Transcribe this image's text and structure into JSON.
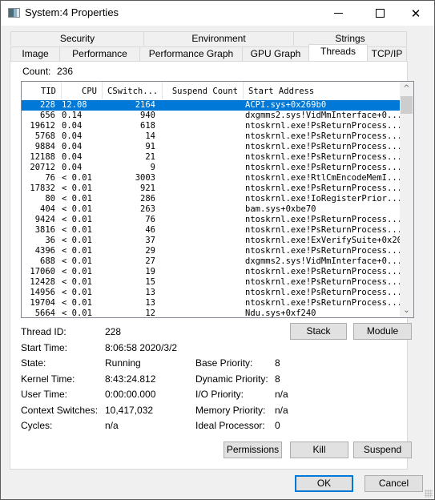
{
  "window": {
    "title": "System:4 Properties",
    "icon": "app-window-icon",
    "controls": {
      "minimize": "minimize-icon",
      "maximize": "maximize-icon",
      "close": "✕"
    }
  },
  "tabs": {
    "row1": [
      {
        "label": "Security"
      },
      {
        "label": "Environment"
      },
      {
        "label": "Strings"
      }
    ],
    "row2": [
      {
        "label": "Image"
      },
      {
        "label": "Performance"
      },
      {
        "label": "Performance Graph"
      },
      {
        "label": "GPU Graph"
      },
      {
        "label": "Threads",
        "active": true
      },
      {
        "label": "TCP/IP"
      }
    ]
  },
  "threads": {
    "count_label": "Count:",
    "count_value": "236",
    "columns": [
      "TID",
      "CPU",
      "CSwitch...",
      "Suspend Count",
      "Start Address"
    ],
    "sort_indicator": "˅",
    "rows": [
      {
        "tid": "228",
        "cpu": "12.08",
        "cswitch": "2164",
        "suspend": "",
        "address": "ACPI.sys+0x269b0",
        "selected": true
      },
      {
        "tid": "656",
        "cpu": "0.14",
        "cswitch": "940",
        "suspend": "",
        "address": "dxgmms2.sys!VidMmInterface+0..."
      },
      {
        "tid": "19612",
        "cpu": "0.04",
        "cswitch": "618",
        "suspend": "",
        "address": "ntoskrnl.exe!PsReturnProcess..."
      },
      {
        "tid": "5768",
        "cpu": "0.04",
        "cswitch": "14",
        "suspend": "",
        "address": "ntoskrnl.exe!PsReturnProcess..."
      },
      {
        "tid": "9884",
        "cpu": "0.04",
        "cswitch": "91",
        "suspend": "",
        "address": "ntoskrnl.exe!PsReturnProcess..."
      },
      {
        "tid": "12188",
        "cpu": "0.04",
        "cswitch": "21",
        "suspend": "",
        "address": "ntoskrnl.exe!PsReturnProcess..."
      },
      {
        "tid": "20712",
        "cpu": "0.04",
        "cswitch": "9",
        "suspend": "",
        "address": "ntoskrnl.exe!PsReturnProcess..."
      },
      {
        "tid": "76",
        "cpu": "< 0.01",
        "cswitch": "3003",
        "suspend": "",
        "address": "ntoskrnl.exe!RtlCmEncodeMemI..."
      },
      {
        "tid": "17832",
        "cpu": "< 0.01",
        "cswitch": "921",
        "suspend": "",
        "address": "ntoskrnl.exe!PsReturnProcess..."
      },
      {
        "tid": "80",
        "cpu": "< 0.01",
        "cswitch": "286",
        "suspend": "",
        "address": "ntoskrnl.exe!IoRegisterPrior..."
      },
      {
        "tid": "404",
        "cpu": "< 0.01",
        "cswitch": "263",
        "suspend": "",
        "address": "bam.sys+0xbe70"
      },
      {
        "tid": "9424",
        "cpu": "< 0.01",
        "cswitch": "76",
        "suspend": "",
        "address": "ntoskrnl.exe!PsReturnProcess..."
      },
      {
        "tid": "3816",
        "cpu": "< 0.01",
        "cswitch": "46",
        "suspend": "",
        "address": "ntoskrnl.exe!PsReturnProcess..."
      },
      {
        "tid": "36",
        "cpu": "< 0.01",
        "cswitch": "37",
        "suspend": "",
        "address": "ntoskrnl.exe!ExVerifySuite+0x20"
      },
      {
        "tid": "4396",
        "cpu": "< 0.01",
        "cswitch": "29",
        "suspend": "",
        "address": "ntoskrnl.exe!PsReturnProcess..."
      },
      {
        "tid": "688",
        "cpu": "< 0.01",
        "cswitch": "27",
        "suspend": "",
        "address": "dxgmms2.sys!VidMmInterface+0..."
      },
      {
        "tid": "17060",
        "cpu": "< 0.01",
        "cswitch": "19",
        "suspend": "",
        "address": "ntoskrnl.exe!PsReturnProcess..."
      },
      {
        "tid": "12428",
        "cpu": "< 0.01",
        "cswitch": "15",
        "suspend": "",
        "address": "ntoskrnl.exe!PsReturnProcess..."
      },
      {
        "tid": "14956",
        "cpu": "< 0.01",
        "cswitch": "13",
        "suspend": "",
        "address": "ntoskrnl.exe!PsReturnProcess..."
      },
      {
        "tid": "19704",
        "cpu": "< 0.01",
        "cswitch": "13",
        "suspend": "",
        "address": "ntoskrnl.exe!PsReturnProcess..."
      },
      {
        "tid": "5664",
        "cpu": "< 0.01",
        "cswitch": "12",
        "suspend": "",
        "address": "Ndu.sys+0xf240"
      }
    ]
  },
  "details": {
    "left": [
      {
        "label": "Thread ID:",
        "value": "228"
      },
      {
        "label": "Start Time:",
        "value": "8:06:58   2020/3/2"
      },
      {
        "label": "State:",
        "value": "Running"
      },
      {
        "label": "Kernel Time:",
        "value": "8:43:24.812"
      },
      {
        "label": "User Time:",
        "value": "0:00:00.000"
      },
      {
        "label": "Context Switches:",
        "value": "10,417,032"
      },
      {
        "label": "Cycles:",
        "value": "n/a"
      }
    ],
    "right": [
      {
        "label": "Base Priority:",
        "value": "8"
      },
      {
        "label": "Dynamic Priority:",
        "value": "8"
      },
      {
        "label": "I/O Priority:",
        "value": "n/a"
      },
      {
        "label": "Memory Priority:",
        "value": "n/a"
      },
      {
        "label": "Ideal Processor:",
        "value": "0"
      }
    ]
  },
  "buttons": {
    "stack": "Stack",
    "module": "Module",
    "permissions": "Permissions",
    "kill": "Kill",
    "suspend": "Suspend",
    "ok": "OK",
    "cancel": "Cancel"
  },
  "colors": {
    "selection": "#0078d7",
    "default_button_border": "#0078d7"
  }
}
